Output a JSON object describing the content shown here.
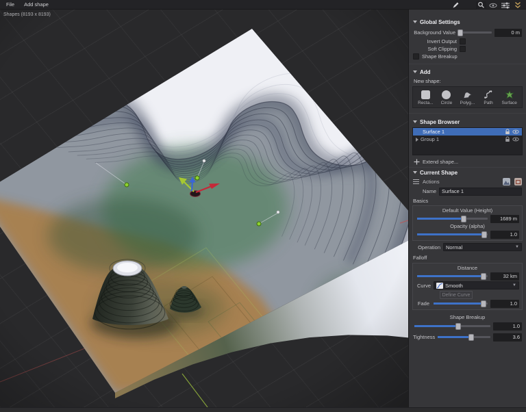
{
  "window": {
    "menu": [
      "File",
      "Add shape"
    ],
    "status": ""
  },
  "viewport": {
    "shapes_label": "Shapes (8193 x 8193)"
  },
  "panel": {
    "global_settings": {
      "title": "Global Settings",
      "background_value": {
        "label": "Background Value",
        "value": "0 m",
        "pct": 2
      },
      "invert_output": "Invert Output",
      "soft_clipping": "Soft Clipping",
      "shape_breakup": "Shape Breakup"
    },
    "add": {
      "title": "Add",
      "new_shape_label": "New shape:",
      "shapes": [
        {
          "label": "Recta..."
        },
        {
          "label": "Circle"
        },
        {
          "label": "Polyg..."
        },
        {
          "label": "Path"
        },
        {
          "label": "Surface"
        }
      ]
    },
    "shape_browser": {
      "title": "Shape Browser",
      "items": [
        {
          "label": "Surface 1"
        },
        {
          "label": "Group 1"
        }
      ],
      "extend_label": "Extend shape..."
    },
    "current_shape": {
      "title": "Current Shape",
      "actions_label": "Actions",
      "name_label": "Name",
      "name_value": "Surface 1",
      "basics_title": "Basics",
      "default_value": {
        "label": "Default Value (Height)",
        "value": "1689 m",
        "pct": 66
      },
      "opacity": {
        "label": "Opacity (alpha)",
        "value": "1.0",
        "pct": 95
      },
      "operation": {
        "label": "Operation",
        "value": "Normal"
      },
      "falloff_title": "Falloff",
      "distance": {
        "label": "Distance",
        "value": "32 km",
        "pct": 94
      },
      "curve": {
        "label": "Curve",
        "value": "Smooth"
      },
      "define_curve_label": "Define Curve",
      "fade": {
        "label": "Fade",
        "value": "1.0",
        "pct": 93
      },
      "shape_breakup": {
        "label": "Shape Breakup",
        "value": "1.0",
        "pct": 58
      },
      "tightness": {
        "label": "Tightness",
        "value": "3.6",
        "pct": 63
      }
    }
  },
  "colors": {
    "accent_blue": "#3e72c8",
    "selection_blue": "#3f6db8",
    "viewport_bg": "#29292b",
    "panel_bg": "#363639",
    "terrain_green": "#3c7a49",
    "terrain_brown": "#a8804f",
    "plateau_white": "#eff0f5",
    "axis_red": "#c05050",
    "axis_green": "#93b33c"
  }
}
